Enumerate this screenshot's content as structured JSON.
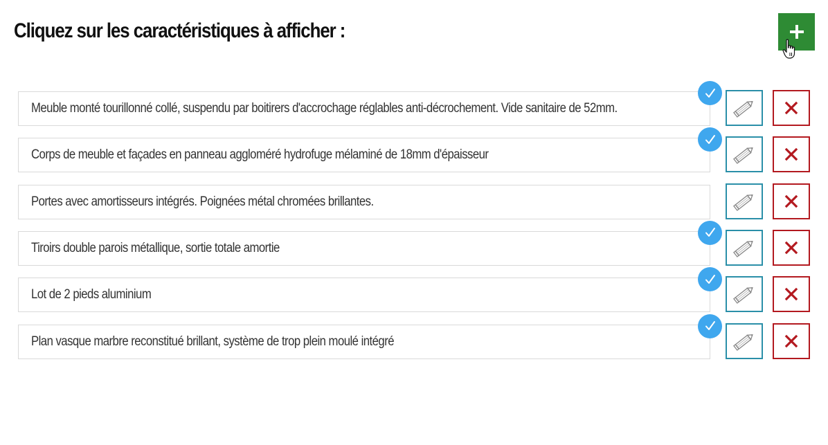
{
  "header": {
    "title": "Cliquez sur les caractéristiques à afficher :"
  },
  "add_button": {
    "icon": "plus-icon",
    "color": "#2e8b34"
  },
  "colors": {
    "check_badge": "#3fa7ee",
    "edit_border": "#2a8fa8",
    "delete_border": "#b3191f",
    "delete_icon": "#b3191f"
  },
  "features": [
    {
      "text": "Meuble monté tourillonné collé, suspendu par boitirers d'accrochage réglables anti-décrochement. Vide sanitaire de 52mm.",
      "checked": true
    },
    {
      "text": "Corps de meuble et façades en panneau aggloméré hydrofuge mélaminé de 18mm d'épaisseur",
      "checked": true
    },
    {
      "text": "Portes avec amortisseurs intégrés. Poignées métal chromées brillantes.",
      "checked": false
    },
    {
      "text": "Tiroirs double parois métallique, sortie totale amortie",
      "checked": true
    },
    {
      "text": "Lot de 2 pieds aluminium",
      "checked": true
    },
    {
      "text": "Plan vasque marbre reconstitué brillant, système de trop plein moulé intégré",
      "checked": true
    }
  ]
}
